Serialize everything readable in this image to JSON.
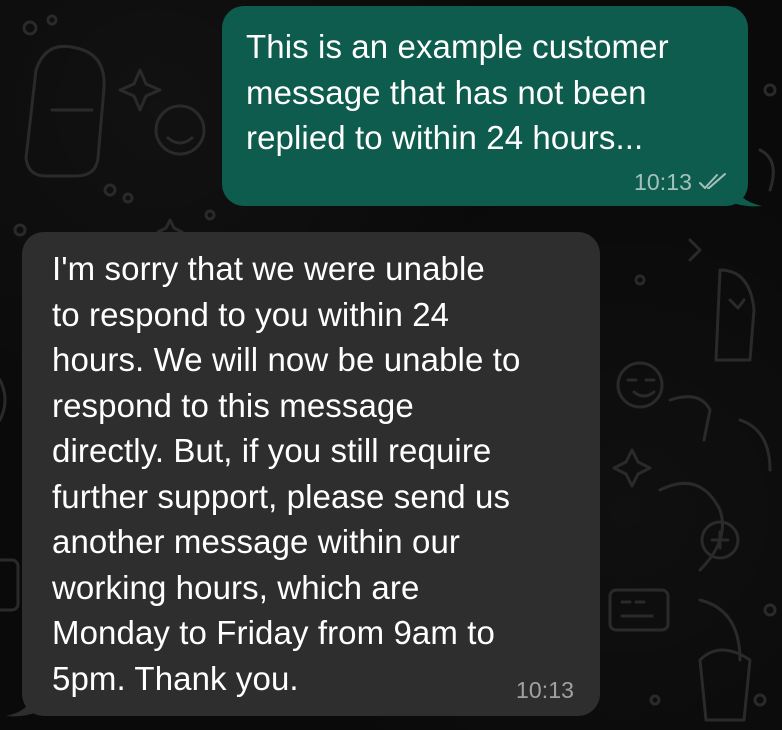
{
  "chat": {
    "messages": [
      {
        "direction": "outgoing",
        "text": "This is an example customer\nmessage that has not been\nreplied to within 24 hours...",
        "time": "10:13",
        "status_icon": "double-check-icon"
      },
      {
        "direction": "incoming",
        "text": "I'm sorry that we were unable\nto respond to you within 24\nhours. We will now be unable to\nrespond to this message\ndirectly. But, if you still require\nfurther support, please send us\nanother message within our\nworking hours, which are\nMonday to Friday from 9am to\n5pm. Thank you.",
        "time": "10:13"
      }
    ]
  },
  "colors": {
    "background": "#0a0a0a",
    "outgoing_bubble": "#0e5c4d",
    "incoming_bubble": "#2e2e2e",
    "text": "#ffffff"
  }
}
